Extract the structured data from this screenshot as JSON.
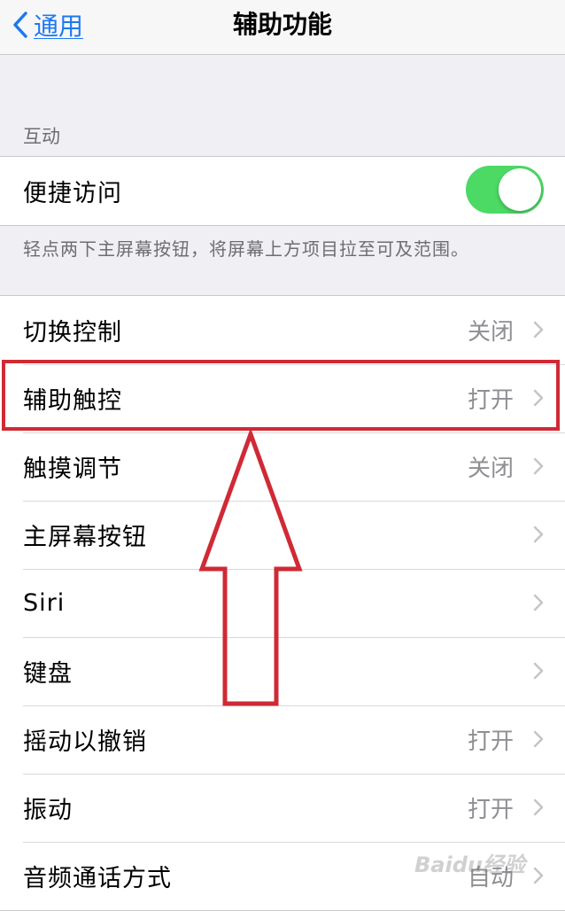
{
  "navbar": {
    "back_label": "通用",
    "title": "辅助功能"
  },
  "interaction_section": {
    "header": "互动",
    "reachability": {
      "label": "便捷访问",
      "toggle_on": true
    },
    "footer": "轻点两下主屏幕按钮，将屏幕上方项目拉至可及范围。"
  },
  "settings_list": [
    {
      "label": "切换控制",
      "value": "关闭"
    },
    {
      "label": "辅助触控",
      "value": "打开"
    },
    {
      "label": "触摸调节",
      "value": "关闭"
    },
    {
      "label": "主屏幕按钮",
      "value": ""
    },
    {
      "label": "Siri",
      "value": ""
    },
    {
      "label": "键盘",
      "value": ""
    },
    {
      "label": "摇动以撤销",
      "value": "打开"
    },
    {
      "label": "振动",
      "value": "打开"
    },
    {
      "label": "音频通话方式",
      "value": "自动"
    }
  ],
  "annotation": {
    "highlight_color": "#cf2a35",
    "target_row": "辅助触控"
  },
  "watermark": "Baidu经验",
  "colors": {
    "accent": "#1c78f2",
    "toggle_on": "#4cd964",
    "background": "#efeff4"
  }
}
